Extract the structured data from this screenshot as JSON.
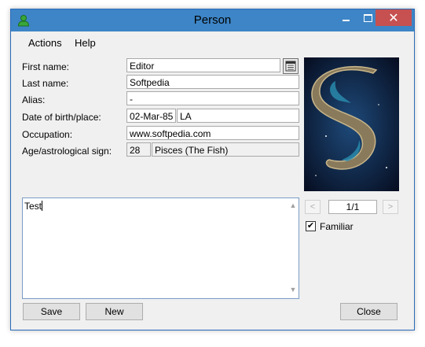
{
  "window": {
    "title": "Person"
  },
  "menu": {
    "actions": "Actions",
    "help": "Help"
  },
  "form": {
    "first_name_label": "First name:",
    "first_name_value": "Editor",
    "last_name_label": "Last name:",
    "last_name_value": "Softpedia",
    "alias_label": "Alias:",
    "alias_value": "-",
    "dob_label": "Date of birth/place:",
    "dob_value": "02-Mar-85",
    "place_value": "LA",
    "occupation_label": "Occupation:",
    "occupation_value": "www.softpedia.com",
    "age_label": "Age/astrological sign:",
    "age_value": "28",
    "sign_value": "Pisces (The Fish)"
  },
  "notes": {
    "text": "Test"
  },
  "photo": {
    "counter": "1/1",
    "prev": "<",
    "next": ">"
  },
  "familiar": {
    "label": "Familiar",
    "checked": true
  },
  "buttons": {
    "save": "Save",
    "new": "New",
    "close": "Close"
  },
  "colors": {
    "titlebar": "#3d85c6",
    "close_button": "#c75050",
    "panel": "#f0f0f0"
  }
}
